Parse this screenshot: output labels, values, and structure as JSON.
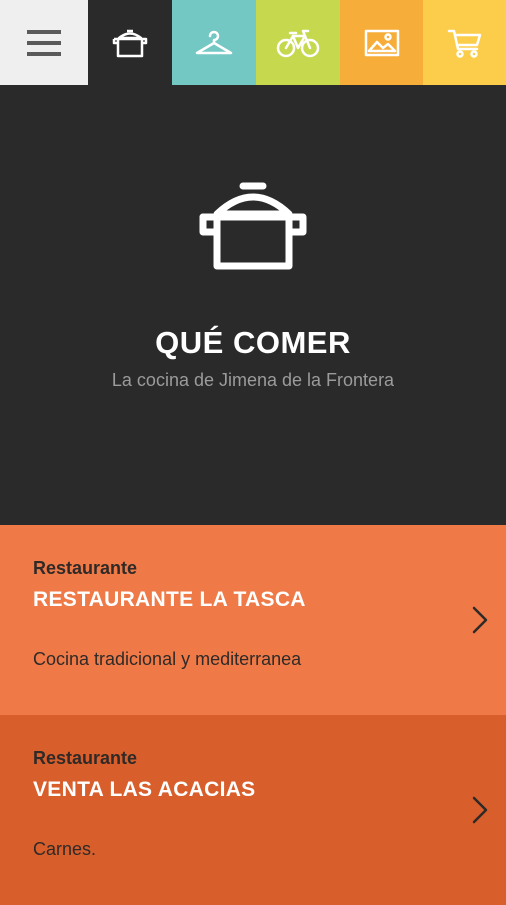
{
  "nav": {
    "tabs": [
      {
        "icon": "menu-icon",
        "color": "#efefef"
      },
      {
        "icon": "cooking-pot-icon",
        "color": "#2a2a2a",
        "active": true
      },
      {
        "icon": "hanger-icon",
        "color": "#74c8c4"
      },
      {
        "icon": "bicycle-icon",
        "color": "#c6d94e"
      },
      {
        "icon": "image-icon",
        "color": "#f6ad3a"
      },
      {
        "icon": "shopping-cart-icon",
        "color": "#fbcd4b"
      }
    ]
  },
  "hero": {
    "icon": "cooking-pot-icon",
    "title": "QUÉ COMER",
    "subtitle": "La cocina de Jimena de la Frontera"
  },
  "cards": [
    {
      "type": "Restaurante",
      "name": "RESTAURANTE LA TASCA",
      "description": "Cocina tradicional y mediterranea",
      "color": "#ef7a48"
    },
    {
      "type": "Restaurante",
      "name": "VENTA LAS ACACIAS",
      "description": "Carnes.",
      "color": "#d85e2b"
    }
  ]
}
